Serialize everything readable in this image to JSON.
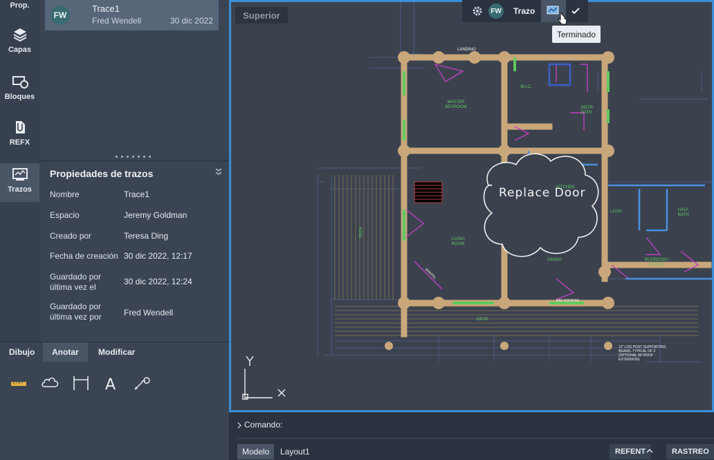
{
  "rail": {
    "items": [
      {
        "label": "Prop.",
        "icon": "properties-icon"
      },
      {
        "label": "Capas",
        "icon": "layers-icon"
      },
      {
        "label": "Bloques",
        "icon": "blocks-icon"
      },
      {
        "label": "REFX",
        "icon": "xref-icon"
      },
      {
        "label": "Trazos",
        "icon": "traces-icon"
      }
    ]
  },
  "trace": {
    "initials": "FW",
    "name": "Trace1",
    "author": "Fred Wendell",
    "date": "30 dic 2022"
  },
  "properties": {
    "title": "Propiedades de trazos",
    "rows": [
      {
        "label": "Nombre",
        "value": "Trace1"
      },
      {
        "label": "Espacio",
        "value": "Jeremy Goldman"
      },
      {
        "label": "Creado por",
        "value": "Teresa Ding"
      },
      {
        "label": "Fecha de creación",
        "value": "30 dic 2022, 12:17"
      },
      {
        "label": "Guardado por última vez el",
        "value": "30 dic 2022, 12:24"
      },
      {
        "label": "Guardado por última vez por",
        "value": "Fred Wendell"
      }
    ]
  },
  "tooltabs": {
    "tabs": [
      "Dibujo",
      "Anotar",
      "Modificar"
    ],
    "active": "Anotar"
  },
  "canvas": {
    "view_label": "Superior",
    "cloud_text": "Replace Door",
    "plan_labels": [
      "LANDING",
      "MASTER BEDROOM",
      "W.I.C.",
      "MSTR BATH",
      "KITCHEN",
      "LIVING ROOM",
      "DINING",
      "DECK",
      "DECK",
      "MUDROOM / UTILITY",
      "HALF BATH",
      "LAUN.",
      "BAY WINDOW",
      "MANTEL",
      "12\" LOG POST SUPPORTING BEAMS. TYPICAL OF 2 (OPTIONAL W/ ROOF EXTENSION)"
    ],
    "ucs": {
      "y": "Y",
      "x": "X"
    }
  },
  "tracebar": {
    "initials": "FW",
    "label": "Trazo",
    "tooltip": "Terminado"
  },
  "command": {
    "prompt": "Comando:"
  },
  "status": {
    "tabs": [
      "Modelo",
      "Layout1"
    ],
    "buttons": [
      "REFENT",
      "RASTREO"
    ]
  },
  "colors": {
    "accent": "#3b8fd9",
    "wall": "#c9a77a",
    "plan_line": "#5b6fa8",
    "green": "#5fc95f",
    "magenta": "#c040c0"
  }
}
